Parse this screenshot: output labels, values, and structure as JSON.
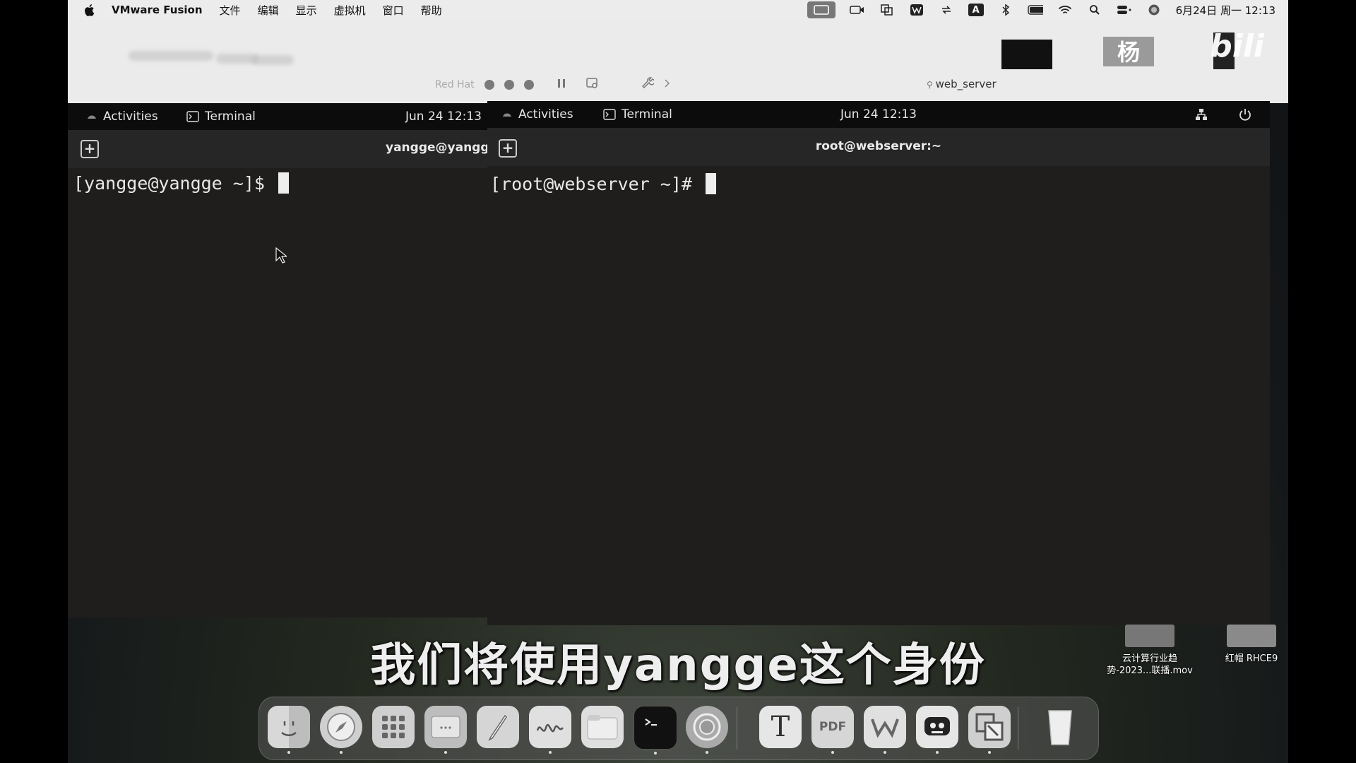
{
  "menubar": {
    "app_name": "VMware Fusion",
    "menus": [
      "文件",
      "编辑",
      "显示",
      "虚拟机",
      "窗口",
      "帮助"
    ],
    "clock": "6月24日 周一 12:13",
    "input_indicator": "A"
  },
  "vmware": {
    "left_tab_label": "Red Hat",
    "window_title": "web_server"
  },
  "left_vm": {
    "activities": "Activities",
    "terminal_app": "Terminal",
    "datetime": "Jun 24  12:13",
    "terminal_title": "yangge@yangge:",
    "prompt": "[yangge@yangge ~]$ "
  },
  "right_vm": {
    "activities": "Activities",
    "terminal_app": "Terminal",
    "datetime": "Jun 24  12:13",
    "terminal_title": "root@webserver:~",
    "prompt": "[root@webserver ~]# "
  },
  "subtitle": "我们将使用yangge这个身份",
  "desktop_files": [
    {
      "label_line1": "云计算行业趋",
      "label_line2": "势-2023...联播.mov"
    },
    {
      "label_line1": "红帽 RHCE9",
      "label_line2": ""
    }
  ],
  "thumbnails": {
    "text": "杨"
  },
  "dock": {
    "items": [
      "finder",
      "safari",
      "launchpad",
      "vmware-window",
      "pencil",
      "freeform",
      "files",
      "terminal",
      "screen-recorder",
      "typora",
      "pdf-expert",
      "wps",
      "chatbot",
      "vmware-fusion",
      "trash"
    ],
    "pdf_label": "PDF",
    "text_label": "T"
  },
  "watermark": "bili"
}
